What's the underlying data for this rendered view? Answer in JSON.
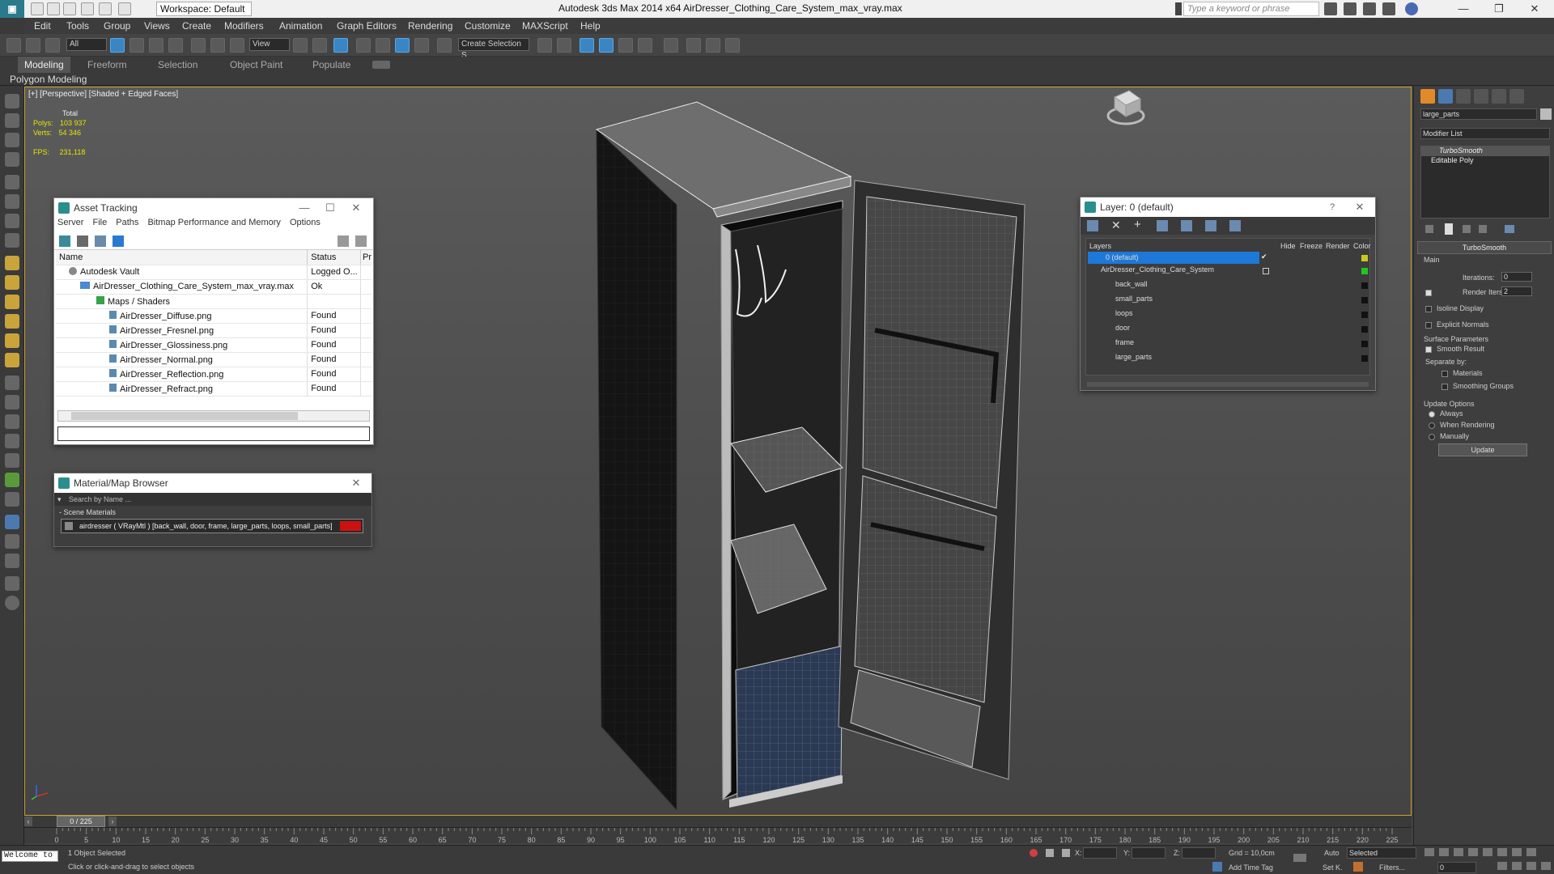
{
  "app": {
    "title": "Autodesk 3ds Max  2014 x64     AirDresser_Clothing_Care_System_max_vray.max",
    "workspace": "Workspace: Default",
    "keyword_search_placeholder": "Type a keyword or phrase"
  },
  "menu": [
    "Edit",
    "Tools",
    "Group",
    "Views",
    "Create",
    "Modifiers",
    "Animation",
    "Graph Editors",
    "Rendering",
    "Customize",
    "MAXScript",
    "Help"
  ],
  "toolbar": {
    "selection_filter": "All",
    "ref_coord": "View",
    "named_selection": "Create Selection S"
  },
  "ribbon": {
    "tabs": [
      "Modeling",
      "Freeform",
      "Selection",
      "Object Paint",
      "Populate"
    ],
    "active_tab": "Modeling",
    "panel_label": "Polygon Modeling"
  },
  "viewport": {
    "label": "[+] [Perspective] [Shaded + Edged Faces]",
    "stats": {
      "header": "Total",
      "polys_label": "Polys:",
      "polys": "103 937",
      "verts_label": "Verts:",
      "verts": "54 346",
      "fps_label": "FPS:",
      "fps": "231,118"
    }
  },
  "asset_tracking": {
    "title": "Asset Tracking",
    "menu": [
      "Server",
      "File",
      "Paths",
      "Bitmap Performance and Memory",
      "Options"
    ],
    "columns": [
      "Name",
      "Status",
      "Pr"
    ],
    "rows": [
      {
        "name": "Autodesk Vault",
        "status": "Logged O..."
      },
      {
        "name": "AirDresser_Clothing_Care_System_max_vray.max",
        "status": "Ok"
      },
      {
        "name": "Maps / Shaders",
        "status": ""
      },
      {
        "name": "AirDresser_Diffuse.png",
        "status": "Found"
      },
      {
        "name": "AirDresser_Fresnel.png",
        "status": "Found"
      },
      {
        "name": "AirDresser_Glossiness.png",
        "status": "Found"
      },
      {
        "name": "AirDresser_Normal.png",
        "status": "Found"
      },
      {
        "name": "AirDresser_Reflection.png",
        "status": "Found"
      },
      {
        "name": "AirDresser_Refract.png",
        "status": "Found"
      }
    ]
  },
  "material_browser": {
    "title": "Material/Map Browser",
    "search_placeholder": "Search by Name ...",
    "section": "- Scene Materials",
    "material": "airdresser ( VRayMtl ) [back_wall, door, frame, large_parts, loops, small_parts]",
    "swatch_color": "#cc1111"
  },
  "layer_window": {
    "title": "Layer: 0 (default)",
    "help": "?",
    "columns": [
      "Layers",
      "Hide",
      "Freeze",
      "Render",
      "Color"
    ],
    "layers": [
      {
        "name": "0 (default)",
        "color": "#c8c820",
        "selected": true
      },
      {
        "name": "AirDresser_Clothing_Care_System",
        "color": "#20c820",
        "selected": false
      },
      {
        "name": "back_wall",
        "color": "#111111",
        "selected": false
      },
      {
        "name": "small_parts",
        "color": "#111111",
        "selected": false
      },
      {
        "name": "loops",
        "color": "#111111",
        "selected": false
      },
      {
        "name": "door",
        "color": "#111111",
        "selected": false
      },
      {
        "name": "frame",
        "color": "#111111",
        "selected": false
      },
      {
        "name": "large_parts",
        "color": "#111111",
        "selected": false
      }
    ]
  },
  "command_panel": {
    "object_name": "large_parts",
    "modifier_list": "Modifier List",
    "stack": [
      "TurboSmooth",
      "Editable Poly"
    ],
    "rollout_title": "TurboSmooth",
    "main_label": "Main",
    "iterations_label": "Iterations:",
    "iterations": "0",
    "render_iters_label": "Render Iters:",
    "render_iters": "2",
    "isoline_display": "Isoline Display",
    "explicit_normals": "Explicit Normals",
    "surface_params": "Surface Parameters",
    "smooth_result": "Smooth Result",
    "separate_by": "Separate by:",
    "materials": "Materials",
    "smoothing_groups": "Smoothing Groups",
    "update_options": "Update Options",
    "always": "Always",
    "when_rendering": "When Rendering",
    "manually": "Manually",
    "update_button": "Update"
  },
  "timeline": {
    "frame": "0 / 225",
    "ticks": [
      "0",
      "5",
      "10",
      "15",
      "20",
      "25",
      "30",
      "35",
      "40",
      "45",
      "50",
      "55",
      "60",
      "65",
      "70",
      "75",
      "80",
      "85",
      "90",
      "95",
      "100",
      "105",
      "110",
      "115",
      "120",
      "125",
      "130",
      "135",
      "140",
      "145",
      "150",
      "155",
      "160",
      "165",
      "170",
      "175",
      "180",
      "185",
      "190",
      "195",
      "200",
      "205",
      "210",
      "215",
      "220",
      "225"
    ]
  },
  "status": {
    "welcome": "Welcome to",
    "selection": "1 Object Selected",
    "prompt": "Click or click-and-drag to select objects",
    "x_label": "X:",
    "y_label": "Y:",
    "z_label": "Z:",
    "grid": "Grid = 10,0cm",
    "add_time_tag": "Add Time Tag",
    "auto": "Auto",
    "set_key": "Set K.",
    "key_mode": "Selected",
    "filters": "Filters...",
    "frame_field": "0"
  }
}
